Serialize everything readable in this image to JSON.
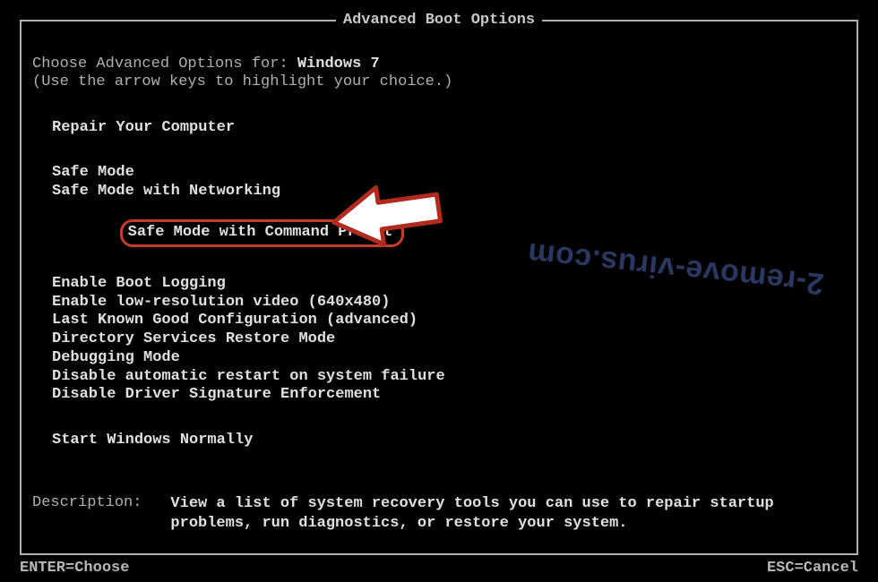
{
  "title": "Advanced Boot Options",
  "choose_prefix": "Choose Advanced Options for: ",
  "os_name": "Windows 7",
  "hint": "(Use the arrow keys to highlight your choice.)",
  "repair": "Repair Your Computer",
  "modes": {
    "safe": "Safe Mode",
    "safe_net": "Safe Mode with Networking",
    "safe_cmd": "Safe Mode with Command Prompt"
  },
  "options": [
    "Enable Boot Logging",
    "Enable low-resolution video (640x480)",
    "Last Known Good Configuration (advanced)",
    "Directory Services Restore Mode",
    "Debugging Mode",
    "Disable automatic restart on system failure",
    "Disable Driver Signature Enforcement"
  ],
  "start_normal": "Start Windows Normally",
  "description": {
    "label": "Description:",
    "text": "View a list of system recovery tools you can use to repair startup problems, run diagnostics, or restore your system."
  },
  "footer": {
    "enter": "ENTER=Choose",
    "esc": "ESC=Cancel"
  },
  "watermark": "2-remove-virus.com",
  "highlight_color": "#c33d2e"
}
